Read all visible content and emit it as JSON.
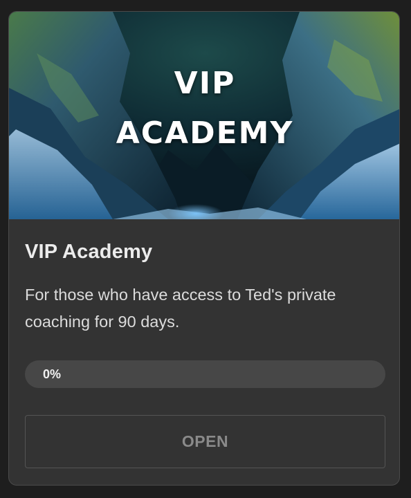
{
  "card": {
    "hero": {
      "line1": "VIP",
      "line2": "ACADEMY",
      "image": "icy-canyon-night-landscape"
    },
    "title": "VIP Academy",
    "description": "For those who have access to Ted's private coaching for 90 days.",
    "progress": {
      "value": 0,
      "label": "0%"
    },
    "open_label": "OPEN"
  },
  "colors": {
    "background": "#1e1e1e",
    "card": "#333333",
    "progress_track": "#474747",
    "button_text": "#8a8a8a"
  }
}
